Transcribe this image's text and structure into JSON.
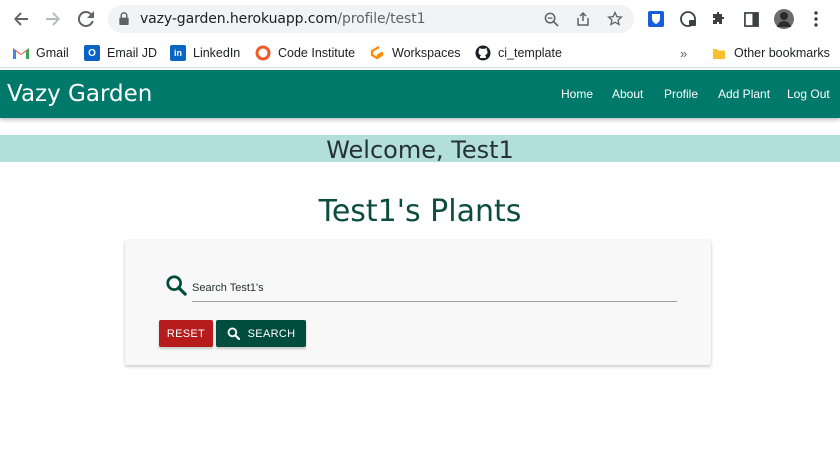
{
  "browser": {
    "url_domain": "vazy-garden.herokuapp.com",
    "url_path": "/profile/test1",
    "icons": [
      "back-arrow-icon",
      "forward-arrow-icon",
      "reload-icon",
      "lock-icon",
      "zoom-icon",
      "share-icon",
      "star-icon",
      "extensions-puzzle-icon",
      "side-panel-icon",
      "profile-avatar-icon",
      "menu-dots-icon"
    ]
  },
  "bookmarks": {
    "items": [
      {
        "label": "Gmail"
      },
      {
        "label": "Email JD"
      },
      {
        "label": "LinkedIn"
      },
      {
        "label": "Code Institute"
      },
      {
        "label": "Workspaces"
      },
      {
        "label": "ci_template"
      }
    ],
    "overflow": "»",
    "other": "Other bookmarks"
  },
  "site": {
    "brand": "Vazy Garden",
    "nav": [
      "Home",
      "About",
      "Profile",
      "Add Plant",
      "Log Out"
    ],
    "welcome": "Welcome, Test1",
    "plants_title": "Test1's Plants",
    "search": {
      "placeholder": "Search Test1's",
      "reset_label": "RESET",
      "search_label": "SEARCH"
    }
  },
  "colors": {
    "navbar": "#00796b",
    "welcome_bg": "#b2dfdb",
    "reset": "#b71c1c",
    "search": "#004d40"
  }
}
